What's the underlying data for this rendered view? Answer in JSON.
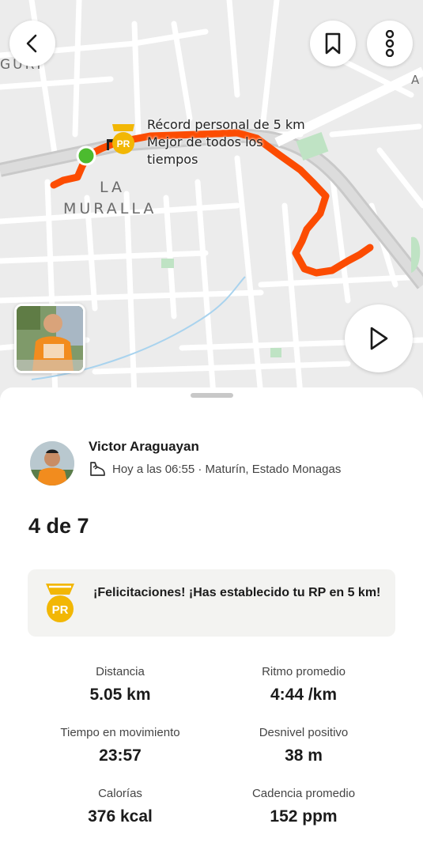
{
  "map": {
    "neighborhood_label_1": "LA",
    "neighborhood_label_2": "MURALLA",
    "edge_label_top_left": "GURI",
    "edge_label_right": "A",
    "pr_callout": {
      "line1": "Récord personal de 5 km",
      "line2": "Mejor de todos los",
      "line3": "tiempos"
    },
    "pr_marker_text": "PR",
    "route_color": "#fc4c02",
    "start_color": "#4cbb2f"
  },
  "toolbar": {
    "back_icon": "chevron-left-icon",
    "bookmark_icon": "bookmark-icon",
    "more_icon": "more-vertical-icon",
    "play_icon": "play-icon"
  },
  "athlete": {
    "name": "Victor Araguayan",
    "meta": "Hoy a las 06:55 · Maturín, Estado Monagas",
    "activity_icon": "run-shoe-icon"
  },
  "activity": {
    "title": "4 de 7"
  },
  "pr_banner": {
    "badge_text": "PR",
    "message": "¡Felicitaciones! ¡Has establecido tu RP en 5 km!"
  },
  "stats": [
    {
      "label": "Distancia",
      "value": "5.05 km"
    },
    {
      "label": "Ritmo promedio",
      "value": "4:44 /km"
    },
    {
      "label": "Tiempo en movimiento",
      "value": "23:57"
    },
    {
      "label": "Desnivel positivo",
      "value": "38 m"
    },
    {
      "label": "Calorías",
      "value": "376 kcal"
    },
    {
      "label": "Cadencia promedio",
      "value": "152 ppm"
    }
  ],
  "colors": {
    "accent": "#fc4c02",
    "pr_gold": "#f2b705",
    "banner_bg": "#f3f3f1"
  }
}
